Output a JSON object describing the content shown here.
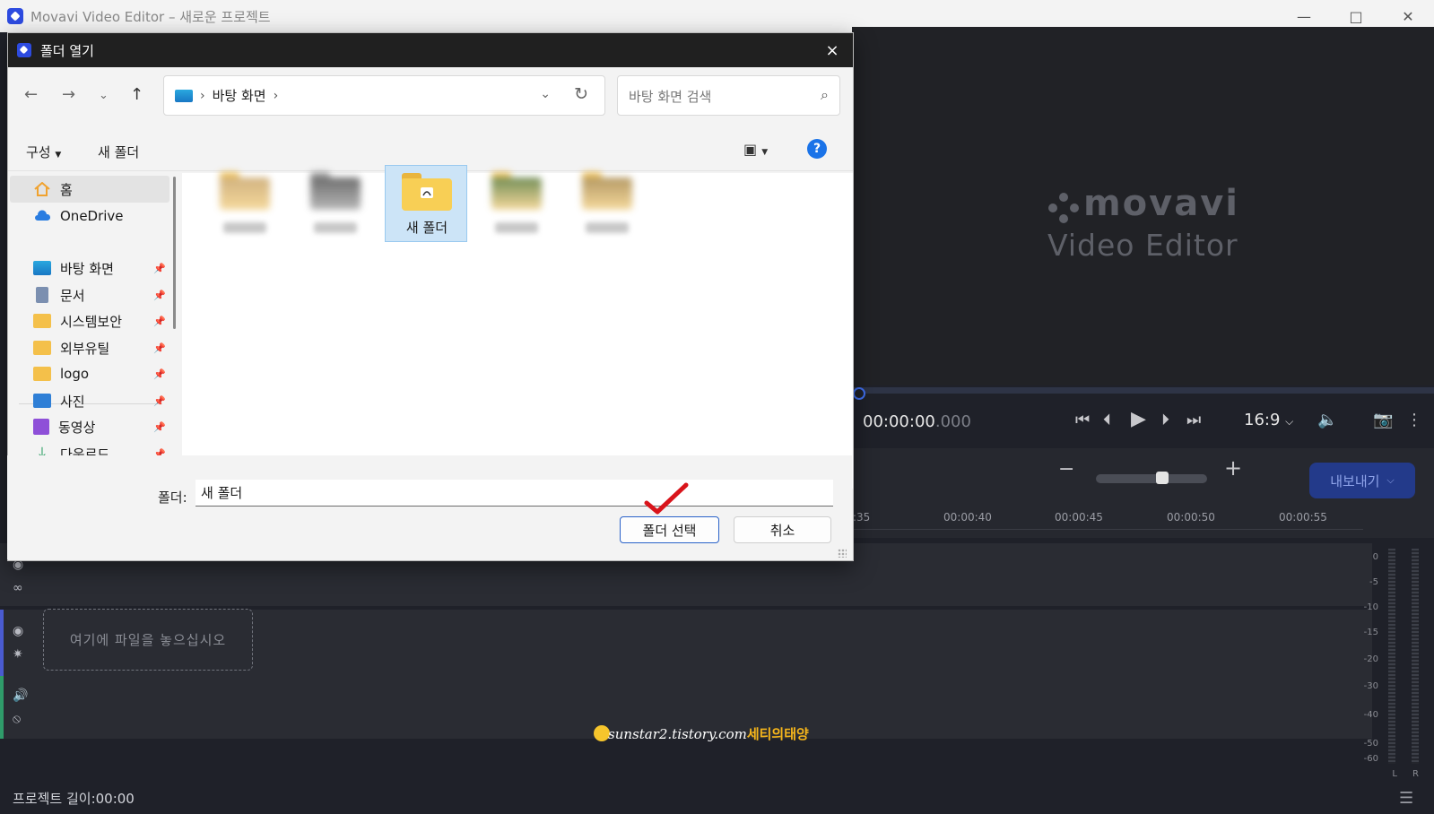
{
  "app": {
    "title": "Movavi Video Editor – 새로운 프로젝트",
    "window_controls": [
      "minimize",
      "maximize",
      "close"
    ]
  },
  "preview": {
    "watermark_logo": "movavi",
    "watermark_sub": "Video Editor",
    "timecode_main": "00:00:00",
    "timecode_ms": ".000",
    "aspect_ratio": "16:9"
  },
  "toolbar": {
    "export_label": "내보내기"
  },
  "timeline": {
    "ruler_labels": [
      ":35",
      "00:00:40",
      "00:00:45",
      "00:00:50",
      "00:00:55"
    ],
    "dropzone_text": "여기에 파일을 놓으십시오",
    "project_length_label": "프로젝트 길이:",
    "project_length_value": "00:00"
  },
  "meter": {
    "labels": [
      "0",
      "-5",
      "-10",
      "-15",
      "-20",
      "-30",
      "-40",
      "-50",
      "-60"
    ],
    "channels": [
      "L",
      "R"
    ]
  },
  "credit": {
    "site": "sunstar2.tistory.com",
    "name": "세티의태양"
  },
  "dialog": {
    "title": "폴더 열기",
    "close": "×",
    "address": {
      "location": "바탕 화면",
      "separator": "›"
    },
    "search_placeholder": "바탕 화면 검색",
    "commands": {
      "organize": "구성",
      "new_folder": "새 폴더"
    },
    "sidebar": [
      {
        "label": "홈",
        "icon": "home-icon",
        "color": "#f0a22f",
        "pinned": false,
        "selected": true
      },
      {
        "label": "OneDrive",
        "icon": "cloud-icon",
        "color": "#2a7de1",
        "pinned": false,
        "selected": false
      },
      {
        "label": "바탕 화면",
        "icon": "desktop-icon",
        "color": "#1e90d6",
        "pinned": true,
        "selected": false
      },
      {
        "label": "문서",
        "icon": "document-icon",
        "color": "#7b8fb0",
        "pinned": true,
        "selected": false
      },
      {
        "label": "시스템보안",
        "icon": "folder-icon",
        "color": "#f4c04a",
        "pinned": true,
        "selected": false
      },
      {
        "label": "외부유틸",
        "icon": "folder-icon",
        "color": "#f4c04a",
        "pinned": true,
        "selected": false
      },
      {
        "label": "logo",
        "icon": "folder-icon",
        "color": "#f4c04a",
        "pinned": true,
        "selected": false
      },
      {
        "label": "사진",
        "icon": "picture-icon",
        "color": "#2f7fd6",
        "pinned": true,
        "selected": false
      },
      {
        "label": "동영상",
        "icon": "video-icon",
        "color": "#8e4fd8",
        "pinned": true,
        "selected": false
      },
      {
        "label": "다운로드",
        "icon": "download-icon",
        "color": "#1e9a5a",
        "pinned": true,
        "selected": false
      }
    ],
    "files": [
      {
        "label": "",
        "blurred": true,
        "selected": false
      },
      {
        "label": "",
        "blurred": true,
        "selected": false
      },
      {
        "label": "새 폴더",
        "blurred": false,
        "selected": true
      },
      {
        "label": "",
        "blurred": true,
        "selected": false
      },
      {
        "label": "",
        "blurred": true,
        "selected": false
      }
    ],
    "folder_label": "폴더:",
    "folder_value": "새 폴더",
    "buttons": {
      "select_folder": "폴더 선택",
      "cancel": "취소"
    }
  }
}
